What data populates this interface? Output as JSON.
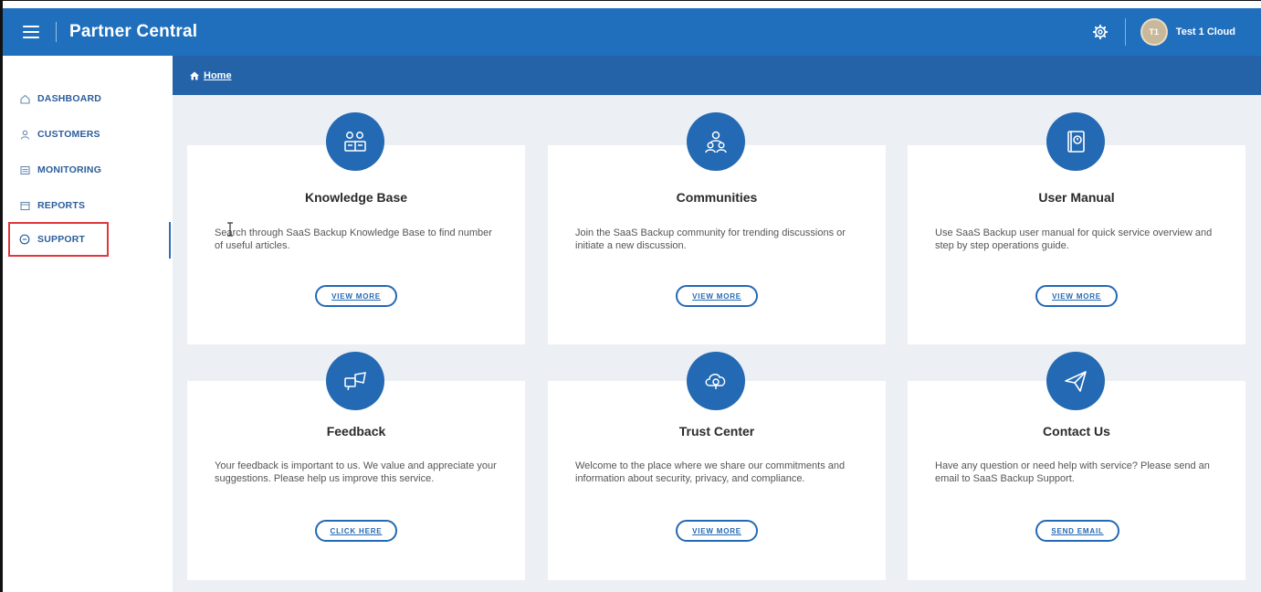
{
  "app": {
    "title": "Partner Central",
    "user": {
      "initials": "T1",
      "name": "Test 1 Cloud"
    }
  },
  "icons": {
    "menu": "hamburger-icon",
    "settings": "settings-icon",
    "home": "home-icon"
  },
  "colors": {
    "topbar": "#1f6fbd",
    "breadcrumb": "#2463a8",
    "accent": "#2369b3",
    "active_highlight": "#e0363d"
  },
  "sidebar": {
    "items": [
      {
        "label": "DASHBOARD",
        "icon": "dashboard-icon",
        "active": false
      },
      {
        "label": "CUSTOMERS",
        "icon": "user-icon",
        "active": false
      },
      {
        "label": "MONITORING",
        "icon": "monitor-icon",
        "active": false
      },
      {
        "label": "REPORTS",
        "icon": "report-icon",
        "active": false
      },
      {
        "label": "SUPPORT",
        "icon": "chat-icon",
        "active": true
      }
    ]
  },
  "breadcrumb": {
    "label": "Home"
  },
  "cards": [
    {
      "title": "Knowledge Base",
      "desc": "Search through SaaS Backup Knowledge Base to find number of useful articles.",
      "button": "VIEW MORE",
      "icon": "knowledge-base-icon"
    },
    {
      "title": "Communities",
      "desc": "Join the SaaS Backup community for trending discussions or initiate a new discussion.",
      "button": "VIEW MORE",
      "icon": "communities-icon"
    },
    {
      "title": "User Manual",
      "desc": "Use SaaS Backup user manual for quick service overview and step by step operations guide.",
      "button": "VIEW MORE",
      "icon": "user-manual-icon"
    },
    {
      "title": "Feedback",
      "desc": "Your feedback is important to us. We value and appreciate your suggestions. Please help us improve this service.",
      "button": "CLICK HERE",
      "icon": "feedback-icon"
    },
    {
      "title": "Trust Center",
      "desc": "Welcome to the place where we share our commitments and information about security, privacy, and compliance.",
      "button": "VIEW MORE",
      "icon": "trust-center-icon"
    },
    {
      "title": "Contact Us",
      "desc": "Have any question or need help with service? Please send an email to SaaS Backup Support.",
      "button": "SEND EMAIL",
      "icon": "paper-plane-icon"
    }
  ]
}
